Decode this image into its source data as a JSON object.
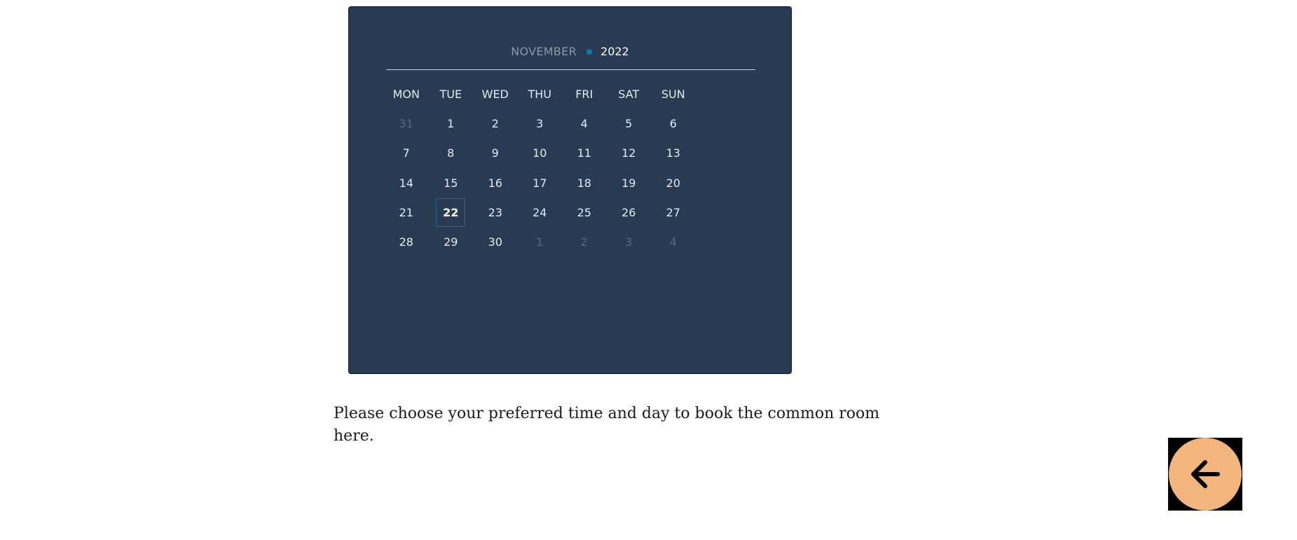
{
  "calendar": {
    "month": "NOVEMBER",
    "year": "2022",
    "weekdays": [
      "MON",
      "TUE",
      "WED",
      "THU",
      "FRI",
      "SAT",
      "SUN"
    ],
    "weeks": [
      [
        {
          "d": "31",
          "muted": true
        },
        {
          "d": "1"
        },
        {
          "d": "2"
        },
        {
          "d": "3"
        },
        {
          "d": "4"
        },
        {
          "d": "5"
        },
        {
          "d": "6"
        }
      ],
      [
        {
          "d": "7"
        },
        {
          "d": "8"
        },
        {
          "d": "9"
        },
        {
          "d": "10"
        },
        {
          "d": "11"
        },
        {
          "d": "12"
        },
        {
          "d": "13"
        }
      ],
      [
        {
          "d": "14"
        },
        {
          "d": "15"
        },
        {
          "d": "16"
        },
        {
          "d": "17"
        },
        {
          "d": "18"
        },
        {
          "d": "19"
        },
        {
          "d": "20"
        }
      ],
      [
        {
          "d": "21"
        },
        {
          "d": "22",
          "today": true
        },
        {
          "d": "23"
        },
        {
          "d": "24"
        },
        {
          "d": "25"
        },
        {
          "d": "26"
        },
        {
          "d": "27"
        }
      ],
      [
        {
          "d": "28"
        },
        {
          "d": "29"
        },
        {
          "d": "30"
        },
        {
          "d": "1",
          "muted": true
        },
        {
          "d": "2",
          "muted": true
        },
        {
          "d": "3",
          "muted": true
        },
        {
          "d": "4",
          "muted": true
        }
      ]
    ]
  },
  "description": "Please choose your preferred time and day to book the common room here.",
  "back_button": {
    "icon": "arrow-left-icon"
  },
  "colors": {
    "calendar_bg": "#283b52",
    "accent_dot": "#1479a8",
    "today_border": "#1b6b8a",
    "back_button_fill": "#f2b57c"
  }
}
